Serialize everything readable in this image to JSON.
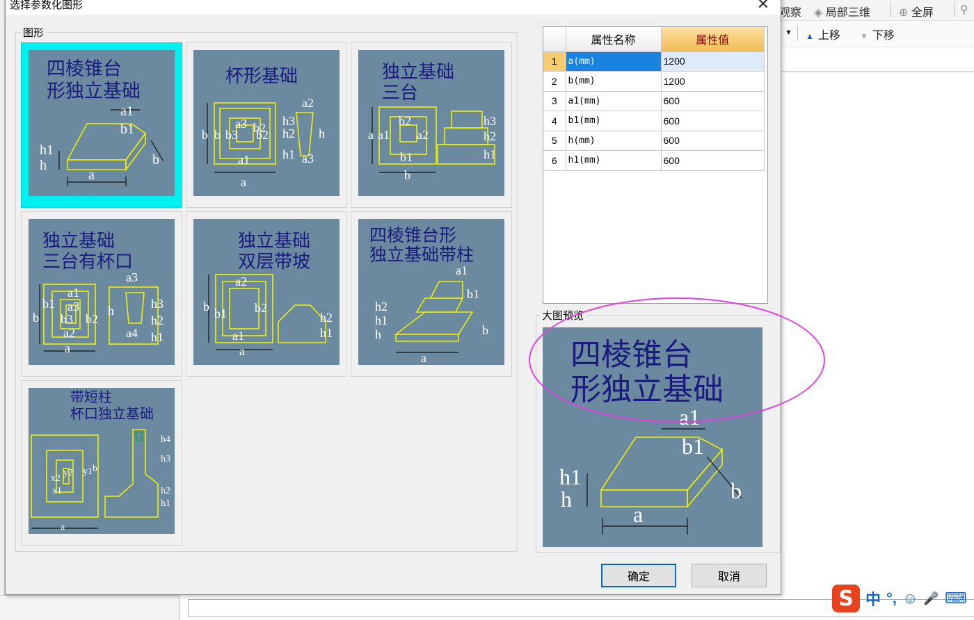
{
  "app": {
    "toolbar": [
      {
        "label": "观察",
        "icon": "eye-icon"
      },
      {
        "label": "局部三维",
        "icon": "cube-icon"
      },
      {
        "label": "全屏",
        "icon": "fullscreen-icon"
      }
    ],
    "toolbar2": [
      {
        "label": "上移",
        "icon": "arrow-up-icon"
      },
      {
        "label": "下移",
        "icon": "arrow-down-icon"
      }
    ]
  },
  "dialog": {
    "title": "选择参数化图形",
    "group_shapes_label": "图形",
    "group_preview_label": "大图预览",
    "ok_label": "确定",
    "cancel_label": "取消"
  },
  "tiles": [
    {
      "id": "t1",
      "title_lines": [
        "四棱锥台",
        "形独立基础"
      ],
      "labels": [
        "a1",
        "b1",
        "h1",
        "h",
        "b",
        "a"
      ],
      "selected": true
    },
    {
      "id": "t2",
      "title_lines": [
        "杯形基础"
      ],
      "labels": [
        "a2",
        "a3",
        "b2",
        "b",
        "b",
        "b3",
        "b2",
        "h3",
        "h2",
        "h1",
        "h",
        "a1",
        "a",
        "a3"
      ],
      "selected": false
    },
    {
      "id": "t3",
      "title_lines": [
        "独立基础",
        "三台"
      ],
      "labels": [
        "b2",
        "a",
        "a1",
        "a2",
        "b1",
        "b",
        "h3",
        "h2",
        "h1"
      ],
      "selected": false
    },
    {
      "id": "t4",
      "title_lines": [
        "独立基础",
        "三台有杯口"
      ],
      "labels": [
        "a1",
        "a3",
        "b1",
        "b",
        "a3",
        "b3",
        "b2",
        "a2",
        "a",
        "h",
        "a4",
        "h3",
        "h2",
        "h1"
      ],
      "selected": false
    },
    {
      "id": "t5",
      "title_lines": [
        "独立基础",
        "双层带坡"
      ],
      "labels": [
        "a2",
        "b",
        "b1",
        "b2",
        "a1",
        "a",
        "h2",
        "h1"
      ],
      "selected": false
    },
    {
      "id": "t6",
      "title_lines": [
        "四棱锥台形",
        "独立基础带柱"
      ],
      "labels": [
        "a1",
        "b1",
        "h2",
        "h1",
        "h",
        "b",
        "a"
      ],
      "selected": false
    },
    {
      "id": "t7",
      "title_lines": [
        "带短柱",
        "杯口独立基础"
      ],
      "labels": [
        "x2",
        "y2",
        "y1",
        "x1",
        "b",
        "a",
        "h4",
        "h3",
        "h2",
        "h1"
      ],
      "selected": false
    }
  ],
  "grid": {
    "col_name": "属性名称",
    "col_value": "属性值",
    "rows": [
      {
        "n": "1",
        "name": "a(mm)",
        "value": "1200",
        "selected": true
      },
      {
        "n": "2",
        "name": "b(mm)",
        "value": "1200"
      },
      {
        "n": "3",
        "name": "a1(mm)",
        "value": "600"
      },
      {
        "n": "4",
        "name": "b1(mm)",
        "value": "600"
      },
      {
        "n": "5",
        "name": "h(mm)",
        "value": "600"
      },
      {
        "n": "6",
        "name": "h1(mm)",
        "value": "600"
      }
    ]
  },
  "preview": {
    "title_lines": [
      "四棱锥台",
      "形独立基础"
    ],
    "labels": [
      "a1",
      "b1",
      "h1",
      "h",
      "b",
      "a"
    ]
  },
  "ime": {
    "items": [
      "中",
      "°,",
      "☺",
      "🎤",
      "⌨"
    ]
  },
  "colors": {
    "tile_bg": "#6b8aa0",
    "outline": "#f0f000",
    "title_text": "#1a1a80",
    "selection": "#00f0f0",
    "annotation": "#e040e0"
  }
}
